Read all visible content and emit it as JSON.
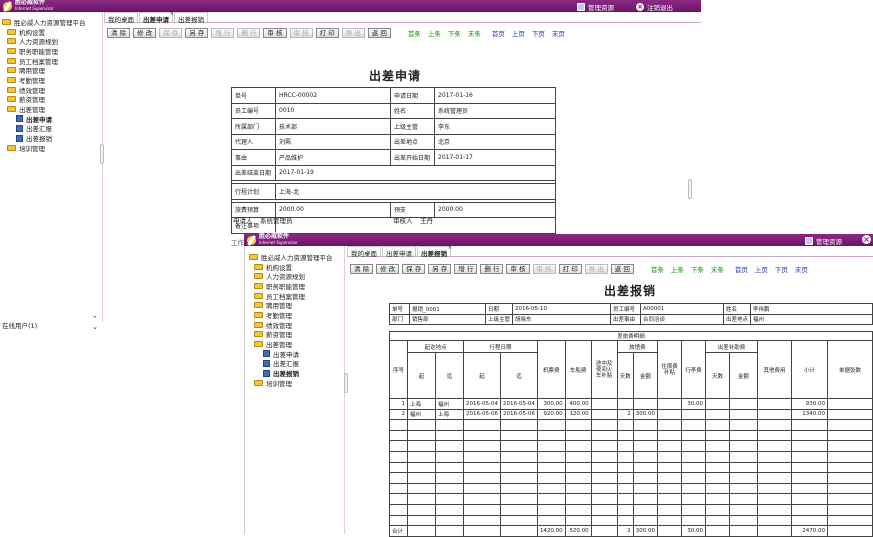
{
  "app": {
    "name_cn": "胜必威软件",
    "name_en": "Internet Supervisor",
    "nav_resource": "管理资源",
    "nav_logout": "注销退出"
  },
  "sidebar1": {
    "root": "胜必威人力资源管理平台",
    "items": [
      "机构设置",
      "人力资源规划",
      "职务职能管理",
      "员工档案管理",
      "聘用管理",
      "考勤管理",
      "绩效管理",
      "薪资管理",
      "出差管理",
      "出差申请",
      "出差汇报",
      "出差报销",
      "培训管理"
    ],
    "bottom": "在线用户(1)"
  },
  "win1": {
    "tabs": [
      "我的桌面",
      "出差申请",
      "出差报销"
    ],
    "buttons": [
      "清 除",
      "修 改",
      "保 存",
      "另 存",
      "增 行",
      "删 行",
      "审 核",
      "审 核",
      "打 印",
      "导 出",
      "返 回"
    ],
    "nav_green": [
      "首条",
      "上条",
      "下条",
      "末条"
    ],
    "nav_blue": [
      "首页",
      "上页",
      "下页",
      "末页"
    ],
    "title": "出差申请",
    "f": {
      "l_no": "单号",
      "v_no": "HRCC-00002",
      "l_date": "申请日期",
      "v_date": "2017-01-16",
      "l_emp": "员工编号",
      "v_emp": "0010",
      "l_name": "姓名",
      "v_name": "系统管理员",
      "l_dept": "所属部门",
      "v_dept": "技术部",
      "l_sup": "上级主管",
      "v_sup": "李东",
      "l_agent": "代理人",
      "v_agent": "刘珮",
      "l_loc": "出差地点",
      "v_loc": "北京",
      "l_reason": "事由",
      "v_reason": "产品维护",
      "l_start": "出差开始日期",
      "v_start": "2017-01-17",
      "l_end": "出差结束日期",
      "v_end": "2017-01-19",
      "l_plan": "行程计划",
      "v_plan": "上海-北",
      "l_budget": "旅费预算",
      "v_budget": "2000.00",
      "l_adv": "预支",
      "v_adv": "2000.00",
      "l_note": "备注事项"
    },
    "applicant_label": "申请人",
    "applicant": "系统管理员",
    "reviewer_label": "审核人",
    "reviewer": "王丹",
    "hidden_label": "工作"
  },
  "win2": {
    "sidebar": {
      "root": "胜必威人力资源管理平台",
      "items": [
        "机构设置",
        "人力资源规划",
        "职务职能管理",
        "员工档案管理",
        "聘用管理",
        "考勤管理",
        "绩效管理",
        "薪资管理",
        "出差管理",
        "出差申请",
        "出差汇报",
        "出差报销",
        "培训管理"
      ]
    },
    "tabs": [
      "我的桌面",
      "出差申请",
      "出差报销"
    ],
    "title": "出差报销",
    "h": {
      "l_no": "单号",
      "v_no": "报销_0001",
      "l_date": "日期",
      "v_date": "2016-05-10",
      "l_emp": "员工编号",
      "v_emp": "A00001",
      "l_name": "姓名",
      "v_name": "李伟鹏",
      "l_dept": "部门",
      "v_dept": "销售部",
      "l_sup": "上级主管",
      "v_sup": "胡晓东",
      "l_reason": "出差事由",
      "v_reason": "合同洽谈",
      "l_loc": "出差地点",
      "v_loc": "福州"
    },
    "th": {
      "detail": "差旅费明细",
      "seq": "序号",
      "place": "起讫地点",
      "from": "起",
      "to": "迄",
      "trip": "行程日期",
      "d_from": "起",
      "d_to": "迄",
      "air": "机票费",
      "car": "车船费",
      "allow": "途中及夜间火车补贴",
      "stay": "旅馆费",
      "days": "天数",
      "amt": "金额",
      "live": "住宿费补贴",
      "misc": "行李费",
      "sub_allow": "出差补助费",
      "days2": "天数",
      "amt2": "金额",
      "other": "其他费用",
      "subtotal": "小计",
      "docs": "单据张数"
    },
    "rows": [
      {
        "seq": "1",
        "from": "上海",
        "to": "福州",
        "d1": "2016-05-04",
        "d2": "2016-05-04",
        "air": "300.00",
        "car": "400.00",
        "days": "",
        "amt": "",
        "misc": "30.00",
        "sub": "930.00"
      },
      {
        "seq": "2",
        "from": "福州",
        "to": "上海",
        "d1": "2016-05-06",
        "d2": "2016-05-06",
        "air": "920.00",
        "car": "120.00",
        "days": "2",
        "amt": "300.00",
        "misc": "",
        "sub": "1340.00"
      }
    ],
    "total": {
      "label": "合计",
      "air": "1420.00",
      "car": "520.00",
      "days": "2",
      "amt": "300.00",
      "misc": "30.00",
      "sub": "2470.00"
    }
  }
}
